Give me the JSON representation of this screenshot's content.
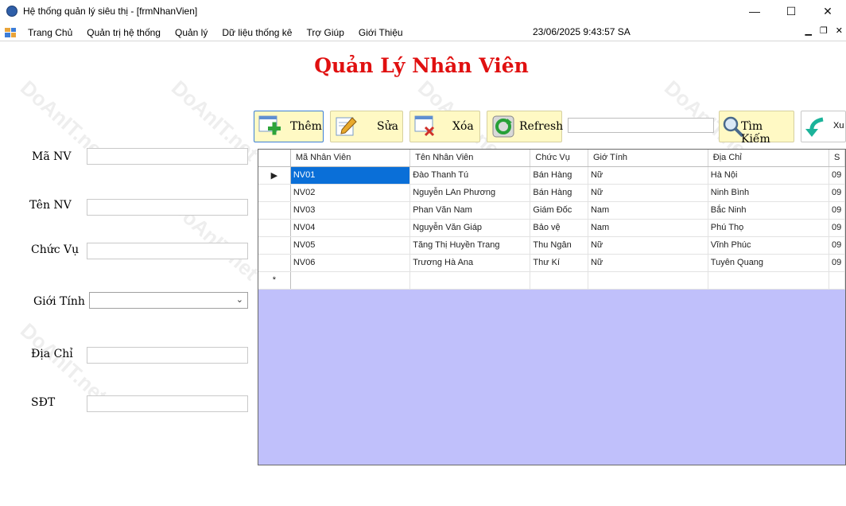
{
  "window": {
    "title": "Hệ thống quản lý siêu thị - [frmNhanVien]",
    "controls": {
      "minimize": "—",
      "maximize": "☐",
      "close": "✕"
    }
  },
  "menu": {
    "items": [
      "Trang Chủ",
      "Quản trị hệ thống",
      "Quản lý",
      "Dữ liệu thống kê",
      "Trợ Giúp",
      "Giới Thiệu"
    ],
    "datetime": "23/06/2025 9:43:57 SA",
    "mdi_controls": {
      "minimize": "▁",
      "restore": "❐",
      "close": "✕"
    }
  },
  "page": {
    "title": "Quản Lý Nhân Viên"
  },
  "form": {
    "ma_nv": {
      "label": "Mã NV",
      "value": ""
    },
    "ten_nv": {
      "label": "Tên NV",
      "value": ""
    },
    "chuc_vu": {
      "label": "Chức Vụ",
      "value": ""
    },
    "gioi_tinh": {
      "label": "Giới Tính",
      "value": ""
    },
    "dia_chi": {
      "label": "Địa Chỉ",
      "value": ""
    },
    "sdt": {
      "label": "SĐT",
      "value": ""
    }
  },
  "toolbar": {
    "add_label": "Thêm",
    "edit_label": "Sửa",
    "delete_label": "Xóa",
    "refresh_label": "Refresh",
    "search_value": "",
    "search_label": "Tìm Kiếm",
    "export_label": "Xu"
  },
  "grid": {
    "columns": [
      "Mã Nhân Viên",
      "Tên Nhân Viên",
      "Chức Vụ",
      "Giớ Tính",
      "Địa Chỉ",
      "S"
    ],
    "rows": [
      [
        "NV01",
        "Đào Thanh Tú",
        "Bán Hàng",
        "Nữ",
        "Hà Nội",
        "09"
      ],
      [
        "NV02",
        "Nguyễn LAn Phương",
        "Bán Hàng",
        "Nữ",
        "Ninh Bình",
        "09"
      ],
      [
        "NV03",
        "Phan Văn Nam",
        "Giám Đốc",
        "Nam",
        "Bắc Ninh",
        "09"
      ],
      [
        "NV04",
        "Nguyễn Văn Giáp",
        "Bảo vệ",
        "Nam",
        "Phú Thọ",
        "09"
      ],
      [
        "NV05",
        "Tăng Thị Huyền Trang",
        "Thu Ngân",
        "Nữ",
        "Vĩnh Phúc",
        "09"
      ],
      [
        "NV06",
        "Trương Hà Ana",
        "Thư Kí",
        "Nữ",
        "Tuyên Quang",
        "09"
      ]
    ],
    "current_row_marker": "▶",
    "new_row_marker": "*"
  },
  "watermark": {
    "text": "DoAnIT.net"
  },
  "colors": {
    "title_red": "#e01010",
    "toolbar_yellow": "#fff9c4",
    "grid_background": "#c0c0fb",
    "selection_blue": "#0a6fd8"
  }
}
